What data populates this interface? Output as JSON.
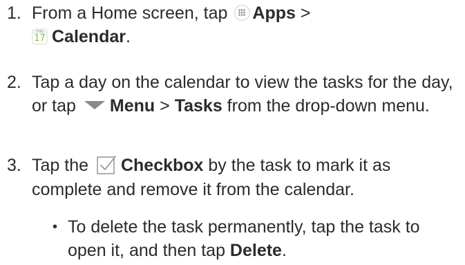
{
  "steps": [
    {
      "number": "1.",
      "segments": {
        "t1": "From a Home screen, tap",
        "apps": "Apps",
        "t2": ">",
        "calendar": "Calendar",
        "t3": "."
      }
    },
    {
      "number": "2.",
      "segments": {
        "t1": "Tap a day on the calendar to view the tasks for the day, or tap",
        "menu": "Menu",
        "t2": ">",
        "tasks": "Tasks",
        "t3": "from the drop-down menu."
      }
    },
    {
      "number": "3.",
      "segments": {
        "t1": "Tap the",
        "checkbox": "Checkbox",
        "t2": "by the task to mark it as complete and remove it from the calendar."
      }
    }
  ],
  "bullet": {
    "marker": "•",
    "t1": "To delete the task permanently, tap the task to open it, and then tap",
    "delete": "Delete",
    "t2": "."
  },
  "icons": {
    "apps": "apps-grid-icon",
    "calendar": "calendar-icon",
    "calendar_day_label": "THU",
    "calendar_day_number": "17",
    "menu": "dropdown-triangle-icon",
    "checkbox": "checkbox-icon"
  },
  "colors": {
    "text": "#2b2b2b",
    "calendar_green": "#7cc242",
    "icon_gray": "#8a8a8a"
  }
}
